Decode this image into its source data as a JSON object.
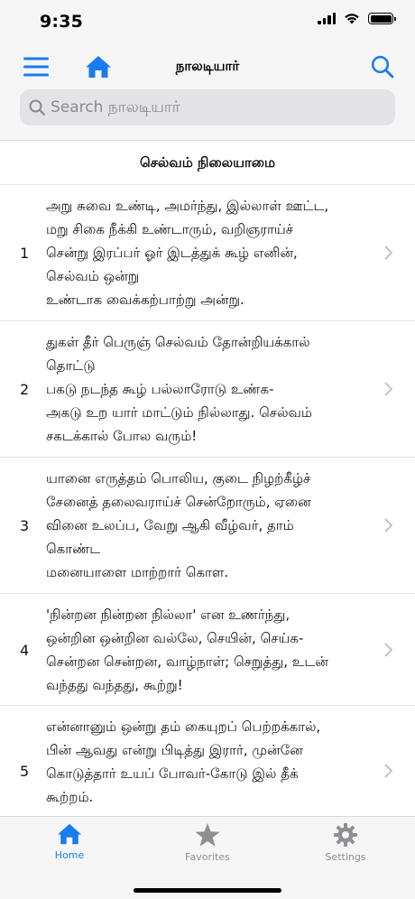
{
  "status_bar": {
    "time": "9:35"
  },
  "nav": {
    "title": "நாலடியார்",
    "menu_icon": "hamburger-icon",
    "home_icon": "house-icon",
    "search_icon": "magnifier-icon"
  },
  "search": {
    "placeholder": "Search நாலடியார்",
    "value": ""
  },
  "section": {
    "title": "செல்வம் நிலையாமை"
  },
  "verses": [
    {
      "num": "1",
      "lines": [
        "அறு சுவை உண்டி, அமர்ந்து, இல்லாள் ஊட்ட,",
        "மறு சிகை நீக்கி உண்டாரும், வறிஞராய்ச்",
        "சென்று இரப்பர் ஓர் இடத்துக் கூழ் எனின்,",
        "செல்வம் ஒன்று",
        "உண்டாக வைக்கற்பாற்று அன்று."
      ]
    },
    {
      "num": "2",
      "lines": [
        "துகள் தீர் பெருஞ் செல்வம் தோன்றியக்கால்",
        "தொட்டு",
        "பகடு நடந்த கூழ் பல்லாரோடு உண்க-",
        "அகடு உற யார் மாட்டும் நில்லாது. செல்வம்",
        "சகடக்கால் போல வரும்!"
      ]
    },
    {
      "num": "3",
      "lines": [
        "யானை எருத்தம் பொலிய, குடை நிழற்கீழ்ச்",
        "சேனைத் தலைவராய்ச் சென்றோரும், ஏனை",
        "வினை உலப்ப, வேறு ஆகி வீழ்வர், தாம்",
        "கொண்ட",
        "மனையாளை மாற்றார் கொள."
      ]
    },
    {
      "num": "4",
      "lines": [
        "'நின்றன நின்றன நில்லா' என உணர்ந்து,",
        "ஒன்றின ஒன்றின வல்லே, செயின், செய்க-",
        "சென்றன சென்றன, வாழ்நாள்; செறுத்து, உடன்",
        "வந்தது வந்தது, கூற்று!"
      ]
    },
    {
      "num": "5",
      "lines": [
        "என்னானும் ஒன்று தம் கையுறப் பெற்றக்கால்,",
        "பின் ஆவது என்று பிடித்து இரார், முன்னே",
        "கொடுத்தார் உயப் போவர்-கோடு இல் தீக்",
        "கூற்றம்."
      ]
    }
  ],
  "tabs": [
    {
      "label": "Home",
      "icon": "house-icon",
      "active": true
    },
    {
      "label": "Favorites",
      "icon": "star-icon",
      "active": false
    },
    {
      "label": "Settings",
      "icon": "gear-icon",
      "active": false
    }
  ],
  "colors": {
    "accent": "#1a7cf0",
    "inactive": "#8e8e93",
    "bar_bg": "#f6f6f7"
  }
}
